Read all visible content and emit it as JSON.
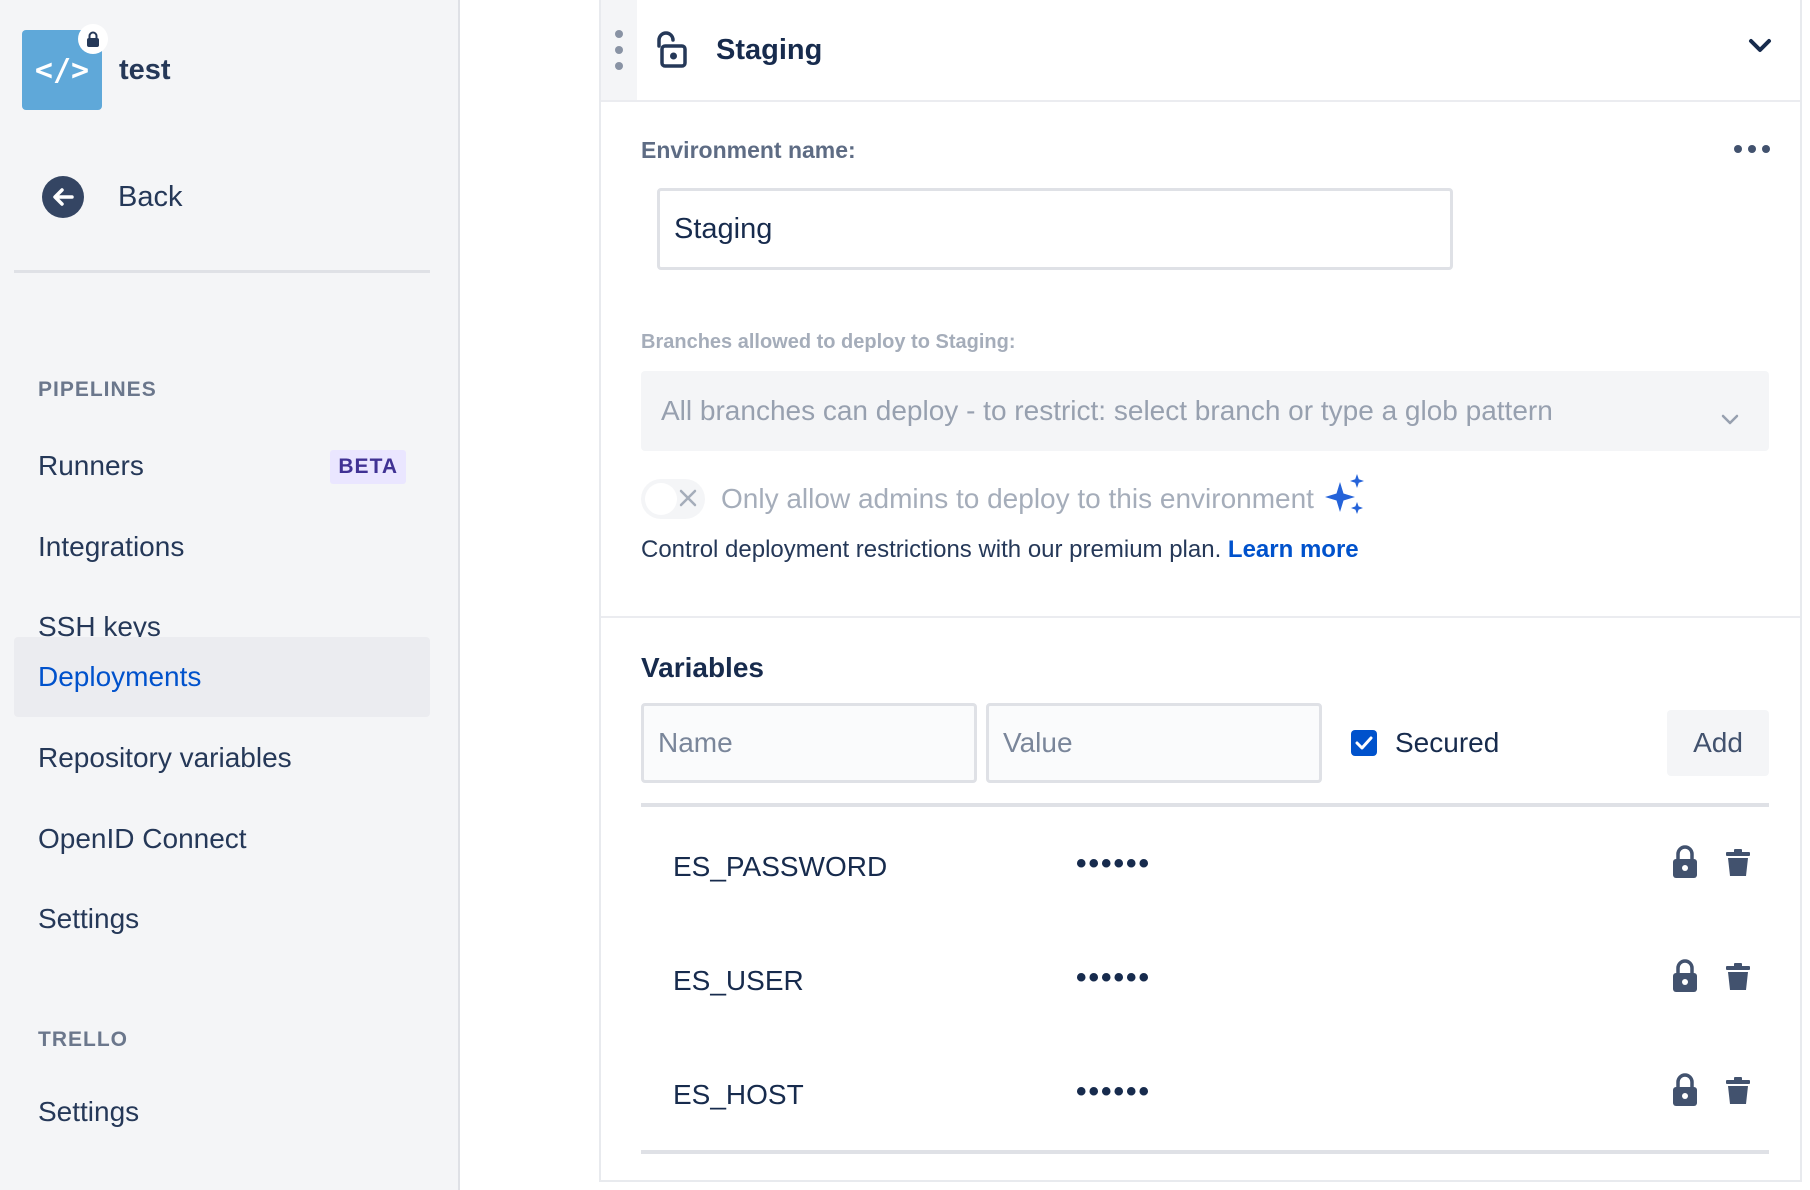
{
  "colors": {
    "accent": "#0052cc",
    "sidebar_bg": "#f4f5f7",
    "repo_avatar": "#5fa8d9",
    "sparkle": "#2563d9"
  },
  "repo": {
    "name": "test",
    "avatar_glyph": "</>",
    "avatar_icon": "code-icon",
    "badge_icon": "lock-icon"
  },
  "sidebar": {
    "back_label": "Back",
    "sections": [
      {
        "heading": "PIPELINES",
        "items": [
          {
            "label": "Runners",
            "badge": "BETA"
          },
          {
            "label": "Integrations"
          },
          {
            "label": "SSH keys"
          },
          {
            "label": "Deployments",
            "active": true
          },
          {
            "label": "Repository variables"
          },
          {
            "label": "OpenID Connect"
          },
          {
            "label": "Settings"
          }
        ]
      },
      {
        "heading": "TRELLO",
        "items": [
          {
            "label": "Settings"
          }
        ]
      }
    ]
  },
  "environment": {
    "title": "Staging",
    "name_label": "Environment name:",
    "name_value": "Staging",
    "branches_label": "Branches allowed to deploy to Staging:",
    "branches_placeholder": "All branches can deploy - to restrict: select branch or type a glob pattern",
    "admin_toggle_label": "Only allow admins to deploy to this environment",
    "admin_toggle_on": false,
    "premium_text": "Control deployment restrictions with our premium plan.",
    "learn_more": "Learn more"
  },
  "variables": {
    "title": "Variables",
    "name_placeholder": "Name",
    "value_placeholder": "Value",
    "secured_label": "Secured",
    "secured_checked": true,
    "add_label": "Add",
    "rows": [
      {
        "name": "ES_PASSWORD",
        "value": "••••••"
      },
      {
        "name": "ES_USER",
        "value": "••••••"
      },
      {
        "name": "ES_HOST",
        "value": "••••••"
      }
    ]
  }
}
